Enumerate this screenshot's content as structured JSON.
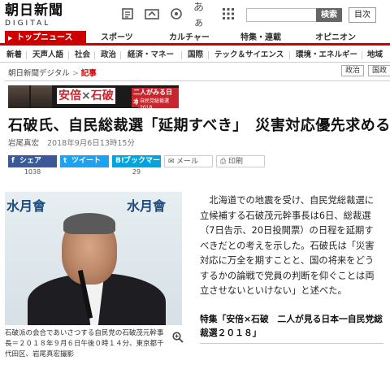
{
  "header": {
    "logo_main": "朝日新聞",
    "logo_sub": "DIGITAL",
    "icons": [
      "newspaper-icon",
      "scrap-icon",
      "settings-icon",
      "font-size-icon",
      "grid-menu-icon"
    ],
    "font_size_label": "あぁ",
    "search_button": "検索",
    "menu_button": "目次"
  },
  "nav_primary": [
    "トップニュース",
    "スポーツ",
    "カルチャー",
    "特集・連載",
    "オピニオン"
  ],
  "nav_secondary": [
    "新着",
    "天声人語",
    "社会",
    "政治",
    "経済・マネー",
    "国際",
    "テック＆サイエンス",
    "環境・エネルギー",
    "地域"
  ],
  "breadcrumb": {
    "home": "朝日新聞デジタル",
    "separator": ">",
    "current": "記事"
  },
  "tags": [
    "政治",
    "国政"
  ],
  "banner": {
    "title_a": "安倍",
    "title_x": "×",
    "title_b": "石破",
    "subtitle": "二人がみる日本",
    "subtitle2": "自民党総裁選 2018"
  },
  "article": {
    "headline": "石破氏、自民総裁選「延期すべき」　災害対応優先求める",
    "author": "岩尾真宏",
    "date": "2018年9月6日13時15分",
    "body": "北海道での地震を受け、自民党総裁選に立候補する石破茂元幹事長は6日、総裁選（7日告示、20日投開票）の日程を延期すべきだとの考えを示した。石破氏は「災害対応に万全を期すことと、国の将来をどうするかの論戦で党員の判断を仰ぐことは両立させないといけない」と述べた。"
  },
  "share": {
    "facebook": {
      "label": "シェア",
      "count": "1038",
      "color": "#3b5998"
    },
    "twitter": {
      "label": "ツイート",
      "count": "",
      "color": "#1da1f2"
    },
    "hatena": {
      "label": "ブックマーク",
      "count": "29",
      "color": "#00a4de"
    },
    "mail": {
      "label": "メール"
    },
    "print": {
      "label": "印刷"
    }
  },
  "photo": {
    "sign_text": "水月會",
    "caption": "石破派の会合であいさつする自民党の石破茂元幹事長＝２０１８年９月６日午後０時１４分、東京都千代田区、岩尾真宏撮影"
  },
  "special": {
    "text": "特集「安倍×石破　二人が見る日本一自民党総裁選２０１８」"
  },
  "colors": {
    "accent": "#cc0000",
    "banner_red": "#c8262e"
  }
}
